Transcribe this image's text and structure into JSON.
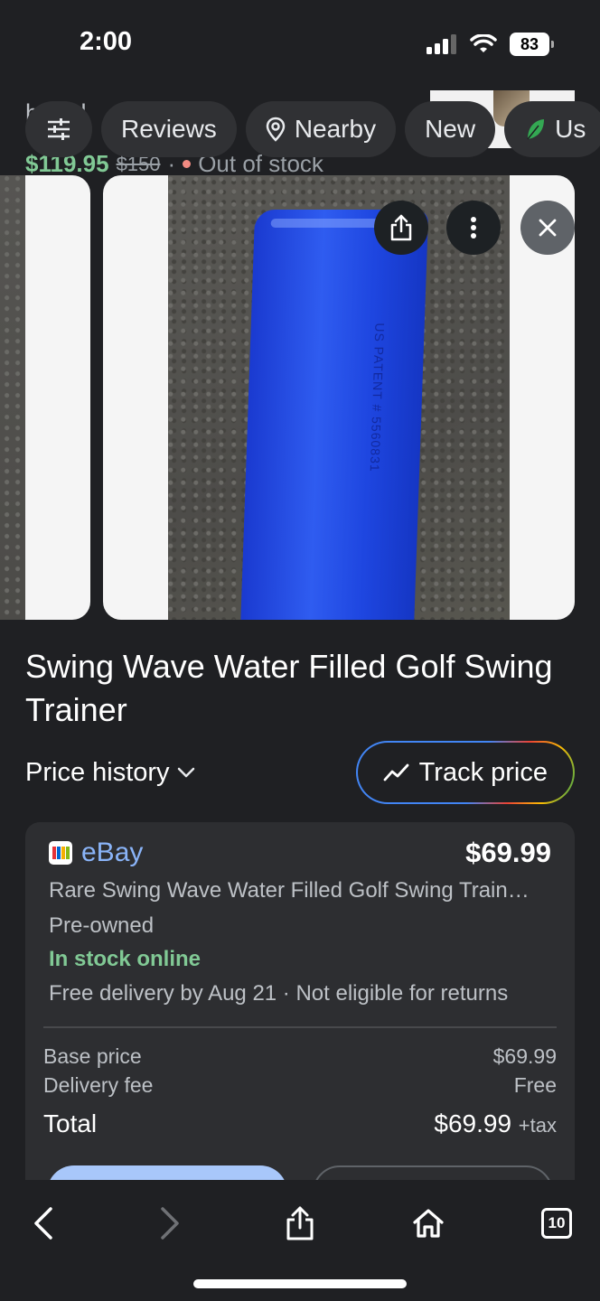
{
  "status": {
    "time": "2:00",
    "battery": "83"
  },
  "behind_card": {
    "title_fragment": "h    te            d",
    "price_now": "$119.95",
    "price_old": "$150",
    "separator": "·",
    "stock": "Out of stock"
  },
  "filters": {
    "chips": [
      {
        "label": "Reviews"
      },
      {
        "label": "Nearby",
        "icon": "location-pin-icon"
      },
      {
        "label": "New"
      },
      {
        "label": "Us",
        "icon": "leaf-icon"
      }
    ]
  },
  "image_actions": [
    "share-icon",
    "more-vert-icon",
    "close-icon"
  ],
  "product": {
    "title": "Swing Wave Water Filled Golf Swing Trainer",
    "tube_imprint": "US PATENT # 5560831"
  },
  "price_history": {
    "label": "Price history",
    "track_label": "Track price"
  },
  "offer": {
    "seller": "eBay",
    "price": "$69.99",
    "listing_title": "Rare Swing Wave Water Filled Golf Swing Train…",
    "condition": "Pre-owned",
    "availability": "In stock online",
    "delivery": "Free delivery by Aug 21 · Not eligible for returns",
    "base_price_label": "Base price",
    "base_price": "$69.99",
    "delivery_fee_label": "Delivery fee",
    "delivery_fee": "Free",
    "total_label": "Total",
    "total": "$69.99",
    "tax": "+tax"
  },
  "toolbar": {
    "tabs_count": "10"
  },
  "colors": {
    "background": "#1f2023",
    "card": "#2d2e31",
    "link_blue": "#8ab4f8",
    "price_green": "#81c995",
    "out_of_stock_red": "#f28b82"
  }
}
